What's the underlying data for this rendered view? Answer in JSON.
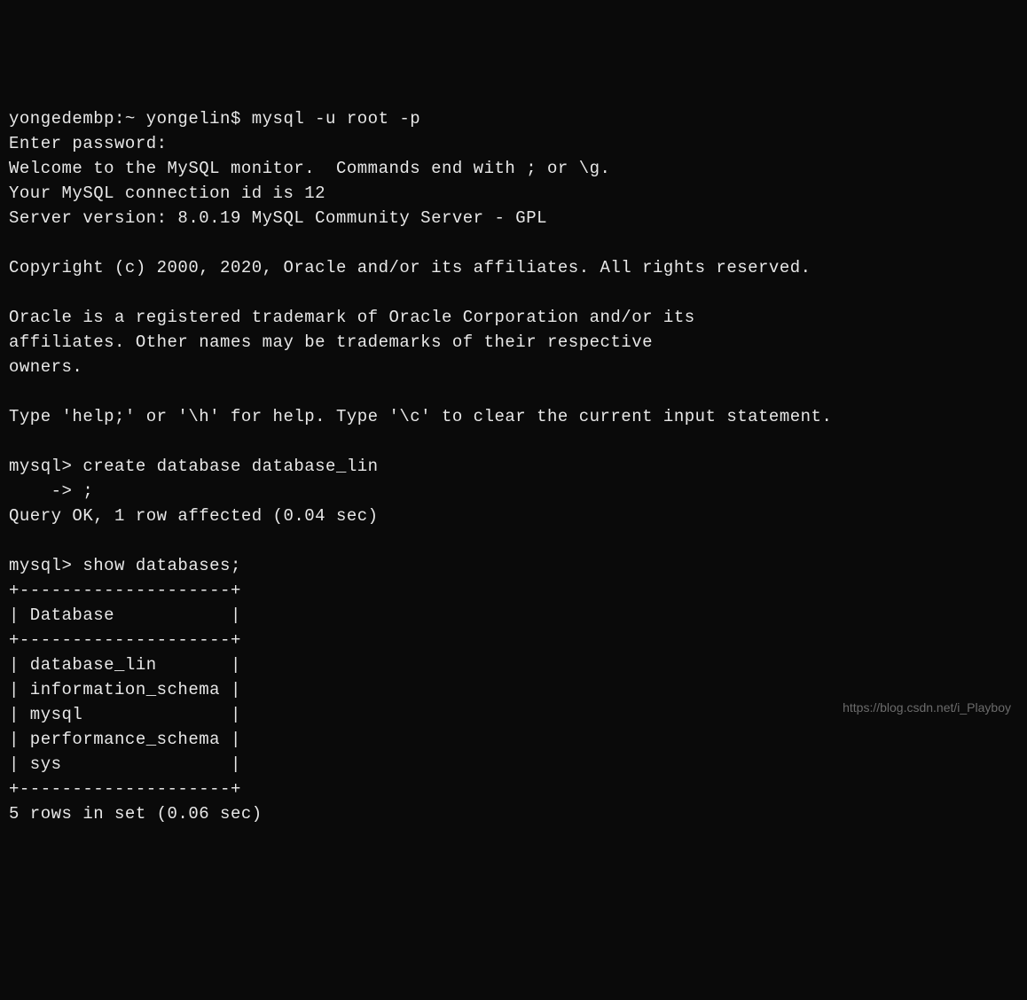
{
  "terminal": {
    "lines": [
      "yongedembp:~ yongelin$ mysql -u root -p",
      "Enter password: ",
      "Welcome to the MySQL monitor.  Commands end with ; or \\g.",
      "Your MySQL connection id is 12",
      "Server version: 8.0.19 MySQL Community Server - GPL",
      "",
      "Copyright (c) 2000, 2020, Oracle and/or its affiliates. All rights reserved.",
      "",
      "Oracle is a registered trademark of Oracle Corporation and/or its",
      "affiliates. Other names may be trademarks of their respective",
      "owners.",
      "",
      "Type 'help;' or '\\h' for help. Type '\\c' to clear the current input statement.",
      "",
      "mysql> create database database_lin",
      "    -> ;",
      "Query OK, 1 row affected (0.04 sec)",
      "",
      "mysql> show databases;",
      "+--------------------+",
      "| Database           |",
      "+--------------------+",
      "| database_lin       |",
      "| information_schema |",
      "| mysql              |",
      "| performance_schema |",
      "| sys                |",
      "+--------------------+",
      "5 rows in set (0.06 sec)"
    ],
    "shell_prompt": "yongedembp:~ yongelin$",
    "shell_command": "mysql -u root -p",
    "mysql_version": "8.0.19",
    "connection_id": 12,
    "create_db_name": "database_lin",
    "create_result": "Query OK, 1 row affected (0.04 sec)",
    "databases": [
      "database_lin",
      "information_schema",
      "mysql",
      "performance_schema",
      "sys"
    ],
    "show_result": "5 rows in set (0.06 sec)"
  },
  "watermark": "https://blog.csdn.net/i_Playboy"
}
